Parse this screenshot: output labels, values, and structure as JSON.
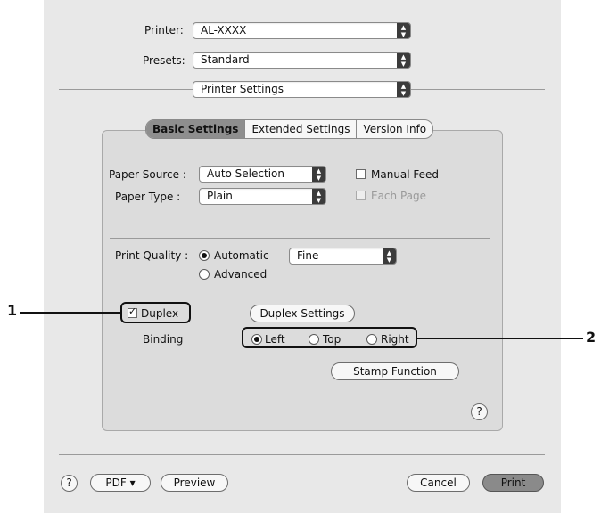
{
  "header": {
    "printer_label": "Printer:",
    "printer_value": "AL-XXXX",
    "presets_label": "Presets:",
    "presets_value": "Standard",
    "panel_value": "Printer Settings"
  },
  "tabs": [
    {
      "label": "Basic Settings",
      "selected": true
    },
    {
      "label": "Extended Settings",
      "selected": false
    },
    {
      "label": "Version Info",
      "selected": false
    }
  ],
  "paper": {
    "source_label": "Paper Source :",
    "source_value": "Auto Selection",
    "type_label": "Paper Type :",
    "type_value": "Plain",
    "manual_feed_label": "Manual Feed",
    "each_page_label": "Each Page"
  },
  "quality": {
    "label": "Print Quality :",
    "automatic_label": "Automatic",
    "advanced_label": "Advanced",
    "mode_value": "Fine"
  },
  "duplex": {
    "checkbox_label": "Duplex",
    "checked": true,
    "settings_button": "Duplex Settings",
    "binding_label": "Binding",
    "left_label": "Left",
    "top_label": "Top",
    "right_label": "Right",
    "selected": "Left"
  },
  "stamp_button": "Stamp Function",
  "footer": {
    "help": "?",
    "pdf_label": "PDF ▾",
    "preview_label": "Preview",
    "cancel_label": "Cancel",
    "print_label": "Print"
  },
  "callouts": {
    "one": "1",
    "two": "2"
  },
  "icons": {
    "popup_arrow": "updown-arrows-icon",
    "help": "question-mark-icon"
  }
}
